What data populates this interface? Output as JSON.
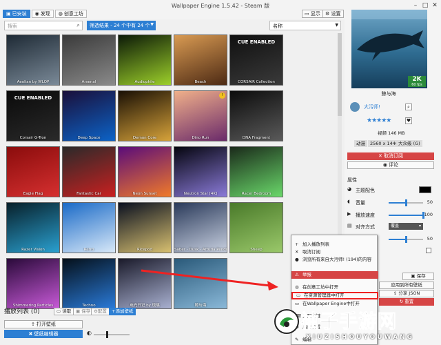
{
  "window": {
    "title": "Wallpaper Engine 1.5.42 - Steam 版"
  },
  "header": {
    "tabs": [
      {
        "label": "已安装"
      },
      {
        "label": "发现"
      },
      {
        "label": "创意工坊"
      }
    ],
    "display_label": "显示",
    "settings_label": "设置"
  },
  "toolbar": {
    "search_placeholder": "搜索",
    "filter_label": "筛选结果 - 24 个中有 24 个",
    "sort_value": "名称"
  },
  "wallpapers": [
    {
      "name": "Aeolian by WLOP",
      "c1": "#1e2a35",
      "c2": "#7b8a98"
    },
    {
      "name": "Arsenal",
      "c1": "#3a3a3a",
      "c2": "#8a8a8a"
    },
    {
      "name": "Audiophile",
      "c1": "#0c1a08",
      "c2": "#9ccf2a"
    },
    {
      "name": "Beach",
      "c1": "#d89a52",
      "c2": "#4d2a14"
    },
    {
      "name": "CORSAIR Collection",
      "c1": "#101010",
      "c2": "#3a3a3a",
      "cue": "CUE ENABLED"
    },
    {
      "name": "Corsair G-Tron",
      "c1": "#0a0a0a",
      "c2": "#2a2a2a",
      "cue": "CUE ENABLED"
    },
    {
      "name": "Deep Space",
      "c1": "#1a0f3a",
      "c2": "#0c63c7"
    },
    {
      "name": "Demon Core",
      "c1": "#1a1005",
      "c2": "#d6a23a"
    },
    {
      "name": "Dino Run",
      "c1": "#f0b08a",
      "c2": "#6a2a6a",
      "badge": true
    },
    {
      "name": "DNA Fragment",
      "c1": "#0c0c0c",
      "c2": "#5a5a5a"
    },
    {
      "name": "Eagle Flag",
      "c1": "#8a0c0c",
      "c2": "#d63030"
    },
    {
      "name": "Fantastic Car",
      "c1": "#2a2a2a",
      "c2": "#c92020"
    },
    {
      "name": "Neon Sunset",
      "c1": "#5a0c7a",
      "c2": "#f07a2a"
    },
    {
      "name": "Neutron Star [4K]",
      "c1": "#05050f",
      "c2": "#8a7ad8"
    },
    {
      "name": "Racer Bedroom",
      "c1": "#1a2a1a",
      "c2": "#6ad86a"
    },
    {
      "name": "Razer Vision",
      "c1": "#08202a",
      "c2": "#2aa0d0"
    },
    {
      "name": "Retro",
      "c1": "#1a6ac7",
      "c2": "#d8e8f8"
    },
    {
      "name": "Ricepod",
      "c1": "#0a1020",
      "c2": "#d8c070"
    },
    {
      "name": "Saber - Dusk - Arturia Pendragon - セイバー【Servant】| Fate Sta",
      "c1": "#2a3a5a",
      "c2": "#c8d0e0"
    },
    {
      "name": "Sheep",
      "c1": "#4a7a2a",
      "c2": "#9ac86a"
    },
    {
      "name": "Shimmering Particles",
      "c1": "#2a0a3a",
      "c2": "#c85ad8"
    },
    {
      "name": "Techno",
      "c1": "#05101a",
      "c2": "#2a7ad8"
    },
    {
      "name": "电光日记 by 琉璃",
      "c1": "#1a1a2a",
      "c2": "#a8b0d0"
    },
    {
      "name": "鲸与海",
      "c1": "#2a5a7a",
      "c2": "#8ab8d8"
    }
  ],
  "playlist": {
    "title": "播放列表",
    "count": "(0)",
    "load": "读取",
    "save": "保存",
    "configure": "配置",
    "add": "添加壁纸"
  },
  "bottom": {
    "open_label": "打开壁纸",
    "editor_label": "壁纸编辑器",
    "volume": 0.35
  },
  "side": {
    "title": "鲸与海",
    "resolution_badge": "2K",
    "fps_badge": "60 fps",
    "author": "大污师!",
    "rating": "★★★★★",
    "type_line": "视频 146 MB",
    "tags": [
      "动漫",
      "2560 x 1440",
      "大众级 (G)"
    ],
    "unsubscribe": "取消订阅",
    "comment": "评论",
    "properties_heading": "属性",
    "props": {
      "color": "主题配色",
      "volume": "音量",
      "volume_value": "50",
      "volume_level": 0.5,
      "speed": "播放速度",
      "speed_value": "100",
      "speed_level": 1,
      "align": "对齐方式",
      "align_value": "覆盖",
      "partial": "位置",
      "partial_value": "50",
      "partial_level": 0.5
    },
    "save": "保存",
    "apply_all": "应用到所有壁纸",
    "share": "分享 JSON",
    "reset": "重置"
  },
  "context_menu": {
    "items": [
      {
        "label": "加入播放列表",
        "icon": "+"
      },
      {
        "label": "取消订阅",
        "icon": "✕"
      },
      {
        "label": "浏览所有来自大污师! (194)的内容",
        "icon": "●"
      },
      {
        "label": "举报",
        "icon": "⚠"
      },
      {
        "label": "在创意工坊中打开",
        "icon": "◎"
      },
      {
        "label": "在资源管理器中打开",
        "icon": "▭"
      },
      {
        "label": "在Wallpaper Engine中打开",
        "icon": "▭"
      },
      {
        "label": "分配热键",
        "icon": "⌨"
      },
      {
        "label": "启动设置",
        "icon": "⚙"
      },
      {
        "label": "编辑",
        "icon": "✎"
      }
    ]
  },
  "watermark": {
    "line1": "袖子手游网",
    "line2": "XIUZISHOUYOUWANG"
  }
}
